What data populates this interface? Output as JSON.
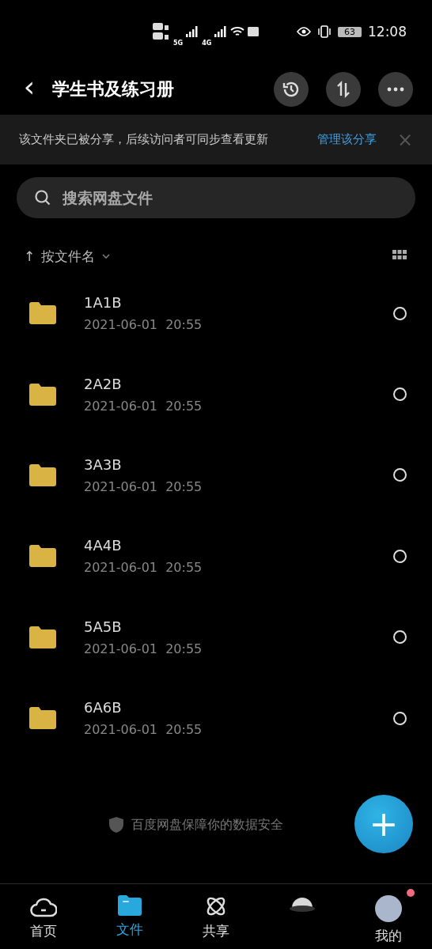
{
  "status_bar": {
    "network_1": "5G",
    "network_2": "4G",
    "battery": "63",
    "time": "12:08"
  },
  "header": {
    "back": "‹",
    "title": "学生书及练习册"
  },
  "share_banner": {
    "message": "该文件夹已被分享，后续访问者可同步查看更新",
    "action": "管理该分享",
    "close": "×"
  },
  "search": {
    "placeholder": "搜索网盘文件"
  },
  "sort": {
    "arrow": "↑",
    "label": "按文件名"
  },
  "files": [
    {
      "name": "1A1B",
      "date": "2021-06-01  20:55",
      "selected": false
    },
    {
      "name": "2A2B",
      "date": "2021-06-01  20:55",
      "selected": false
    },
    {
      "name": "3A3B",
      "date": "2021-06-01  20:55",
      "selected": false
    },
    {
      "name": "4A4B",
      "date": "2021-06-01  20:55",
      "selected": false
    },
    {
      "name": "5A5B",
      "date": "2021-06-01  20:55",
      "selected": false
    },
    {
      "name": "6A6B",
      "date": "2021-06-01  20:55",
      "selected": false
    }
  ],
  "footer_note": "百度网盘保障你的数据安全",
  "fab": "+",
  "nav": [
    {
      "kind": "home",
      "label": "首页",
      "selected": false
    },
    {
      "kind": "files",
      "label": "文件",
      "selected": true
    },
    {
      "kind": "share",
      "label": "共享",
      "selected": false
    },
    {
      "kind": "planet",
      "selected": false
    },
    {
      "kind": "profile",
      "label": "我的",
      "selected": false,
      "badge": true
    }
  ]
}
